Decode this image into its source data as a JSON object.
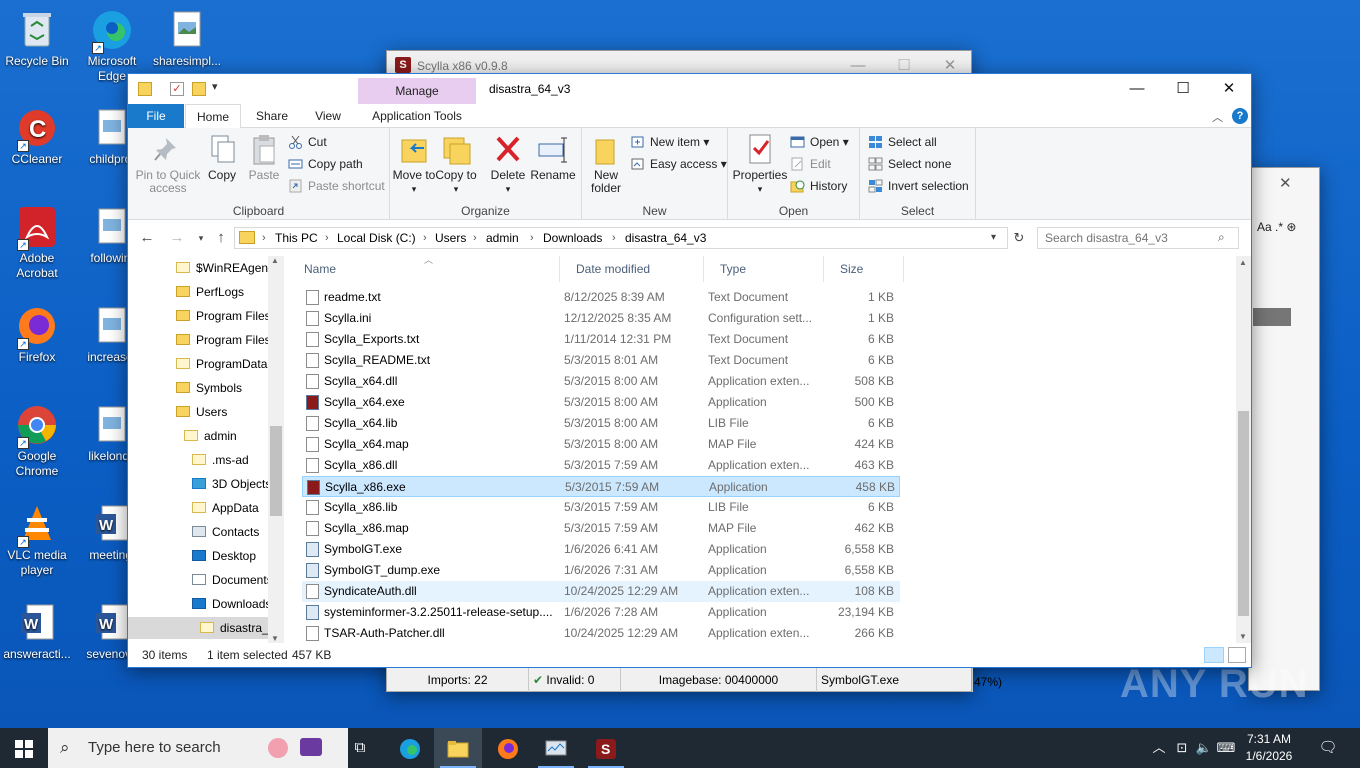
{
  "desktop_icons": [
    {
      "label": "Recycle Bin"
    },
    {
      "label": "Microsoft Edge"
    },
    {
      "label": "sharesimpl..."
    },
    {
      "label": "CCleaner"
    },
    {
      "label": "childprof"
    },
    {
      "label": "Adobe Acrobat"
    },
    {
      "label": "followint"
    },
    {
      "label": "Firefox"
    },
    {
      "label": "increaser"
    },
    {
      "label": "Google Chrome"
    },
    {
      "label": "likelondo"
    },
    {
      "label": "VLC media player"
    },
    {
      "label": "meetingl"
    },
    {
      "label": "answeracti..."
    },
    {
      "label": "sevenove"
    }
  ],
  "scylla_window": {
    "title": "Scylla x86 v0.9.8",
    "status": {
      "imports": "Imports: 22",
      "invalid": "Invalid: 0",
      "imagebase": "Imagebase: 00400000",
      "module": "SymbolGT.exe",
      "zoom_fragment": "47%)"
    }
  },
  "explorer": {
    "title": "disastra_64_v3",
    "context_tab": "Manage",
    "tabs": [
      "File",
      "Home",
      "Share",
      "View",
      "Application Tools"
    ],
    "ribbon": {
      "clipboard": {
        "name": "Clipboard",
        "pin": "Pin to Quick access",
        "copy": "Copy",
        "paste": "Paste",
        "cut": "Cut",
        "copy_path": "Copy path",
        "paste_shortcut": "Paste shortcut"
      },
      "organize": {
        "name": "Organize",
        "move_to": "Move to",
        "copy_to": "Copy to",
        "delete": "Delete",
        "rename": "Rename"
      },
      "new": {
        "name": "New",
        "new_folder": "New folder",
        "new_item": "New item",
        "easy_access": "Easy access"
      },
      "open": {
        "name": "Open",
        "properties": "Properties",
        "open": "Open",
        "edit": "Edit",
        "history": "History"
      },
      "select": {
        "name": "Select",
        "select_all": "Select all",
        "select_none": "Select none",
        "invert": "Invert selection"
      }
    },
    "breadcrumb": [
      "This PC",
      "Local Disk (C:)",
      "Users",
      "admin",
      "Downloads",
      "disastra_64_v3"
    ],
    "search_placeholder": "Search disastra_64_v3",
    "nav_items": [
      "$WinREAgent",
      "PerfLogs",
      "Program Files",
      "Program Files",
      "ProgramData",
      "Symbols",
      "Users",
      "admin",
      ".ms-ad",
      "3D Objects",
      "AppData",
      "Contacts",
      "Desktop",
      "Documents",
      "Downloads",
      "disastra_"
    ],
    "columns": {
      "name": "Name",
      "date": "Date modified",
      "type": "Type",
      "size": "Size"
    },
    "files": [
      {
        "name": "readme.txt",
        "date": "8/12/2025 8:39 AM",
        "type": "Text Document",
        "size": "1 KB"
      },
      {
        "name": "Scylla.ini",
        "date": "12/12/2025 8:35 AM",
        "type": "Configuration sett...",
        "size": "1 KB"
      },
      {
        "name": "Scylla_Exports.txt",
        "date": "1/11/2014 12:31 PM",
        "type": "Text Document",
        "size": "6 KB"
      },
      {
        "name": "Scylla_README.txt",
        "date": "5/3/2015 8:01 AM",
        "type": "Text Document",
        "size": "6 KB"
      },
      {
        "name": "Scylla_x64.dll",
        "date": "5/3/2015 8:00 AM",
        "type": "Application exten...",
        "size": "508 KB"
      },
      {
        "name": "Scylla_x64.exe",
        "date": "5/3/2015 8:00 AM",
        "type": "Application",
        "size": "500 KB"
      },
      {
        "name": "Scylla_x64.lib",
        "date": "5/3/2015 8:00 AM",
        "type": "LIB File",
        "size": "6 KB"
      },
      {
        "name": "Scylla_x64.map",
        "date": "5/3/2015 8:00 AM",
        "type": "MAP File",
        "size": "424 KB"
      },
      {
        "name": "Scylla_x86.dll",
        "date": "5/3/2015 7:59 AM",
        "type": "Application exten...",
        "size": "463 KB"
      },
      {
        "name": "Scylla_x86.exe",
        "date": "5/3/2015 7:59 AM",
        "type": "Application",
        "size": "458 KB"
      },
      {
        "name": "Scylla_x86.lib",
        "date": "5/3/2015 7:59 AM",
        "type": "LIB File",
        "size": "6 KB"
      },
      {
        "name": "Scylla_x86.map",
        "date": "5/3/2015 7:59 AM",
        "type": "MAP File",
        "size": "462 KB"
      },
      {
        "name": "SymbolGT.exe",
        "date": "1/6/2026 6:41 AM",
        "type": "Application",
        "size": "6,558 KB"
      },
      {
        "name": "SymbolGT_dump.exe",
        "date": "1/6/2026 7:31 AM",
        "type": "Application",
        "size": "6,558 KB"
      },
      {
        "name": "SyndicateAuth.dll",
        "date": "10/24/2025 12:29 AM",
        "type": "Application exten...",
        "size": "108 KB"
      },
      {
        "name": "systeminformer-3.2.25011-release-setup....",
        "date": "1/6/2026 7:28 AM",
        "type": "Application",
        "size": "23,194 KB"
      },
      {
        "name": "TSAR-Auth-Patcher.dll",
        "date": "10/24/2025 12:29 AM",
        "type": "Application exten...",
        "size": "266 KB"
      }
    ],
    "selected_file": "Scylla_x86.exe",
    "hovered_file": "SyndicateAuth.dll",
    "status": {
      "count": "30 items",
      "selected": "1 item selected",
      "size": "457 KB"
    }
  },
  "taskbar": {
    "search_placeholder": "Type here to search",
    "time": "7:31 AM",
    "date": "1/6/2026"
  },
  "watermark": "ANY RUN",
  "colors": {
    "accent": "#1979ca",
    "selection": "#cce8ff",
    "manage_tab": "#e8cdf0",
    "taskbar": "#1f2933"
  }
}
